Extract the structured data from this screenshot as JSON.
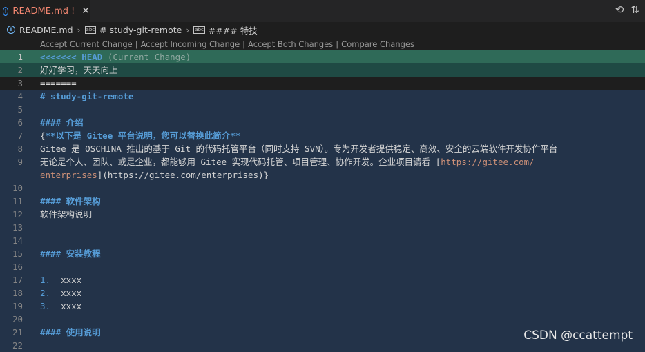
{
  "tab": {
    "filename": "README.md",
    "modified_marker": "!",
    "close": "✕"
  },
  "actions": {
    "timeline": "⟲",
    "compare": "⇅"
  },
  "breadcrumb": {
    "file": "README.md",
    "section1": "# study-git-remote",
    "section2": "#### 特技"
  },
  "codelens": {
    "accept_current": "Accept Current Change",
    "accept_incoming": "Accept Incoming Change",
    "accept_both": "Accept Both Changes",
    "compare": "Compare Changes",
    "separator": "|"
  },
  "lines": [
    {
      "n": "1",
      "parts": [
        {
          "t": "<<<<<<< HEAD ",
          "c": "kw"
        },
        {
          "t": "(Current Change)",
          "c": "dim"
        }
      ],
      "bg": "current"
    },
    {
      "n": "2",
      "parts": [
        {
          "t": "好好学习，天天向上",
          "c": ""
        }
      ],
      "bg": "currentc"
    },
    {
      "n": "3",
      "parts": [
        {
          "t": "=======",
          "c": ""
        }
      ],
      "bg": ""
    },
    {
      "n": "4",
      "parts": [
        {
          "t": "# study-git-remote",
          "c": "kw"
        }
      ],
      "bg": "incoming"
    },
    {
      "n": "5",
      "parts": [],
      "bg": "incoming"
    },
    {
      "n": "6",
      "parts": [
        {
          "t": "#### 介绍",
          "c": "kw"
        }
      ],
      "bg": "incoming"
    },
    {
      "n": "7",
      "parts": [
        {
          "t": "{",
          "c": ""
        },
        {
          "t": "**以下是 Gitee 平台说明，您可以替换此简介**",
          "c": "kw"
        }
      ],
      "bg": "incoming"
    },
    {
      "n": "8",
      "parts": [
        {
          "t": "Gitee 是 OSCHINA 推出的基于 Git 的代码托管平台（同时支持 SVN）。专为开发者提供稳定、高效、安全的云端软件开发协作平台",
          "c": ""
        }
      ],
      "bg": "incoming"
    },
    {
      "n": "9",
      "parts": [
        {
          "t": "无论是个人、团队、或是企业，都能够用 Gitee 实现代码托管、项目管理、协作开发。企业项目请看 [",
          "c": ""
        },
        {
          "t": "https://gitee.com/",
          "c": "link"
        }
      ],
      "bg": "incoming"
    },
    {
      "n": "",
      "parts": [
        {
          "t": "enterprises",
          "c": "link"
        },
        {
          "t": "](https://gitee.com/enterprises)}",
          "c": ""
        }
      ],
      "bg": "incoming"
    },
    {
      "n": "10",
      "parts": [],
      "bg": "incoming"
    },
    {
      "n": "11",
      "parts": [
        {
          "t": "#### 软件架构",
          "c": "kw"
        }
      ],
      "bg": "incoming"
    },
    {
      "n": "12",
      "parts": [
        {
          "t": "软件架构说明",
          "c": ""
        }
      ],
      "bg": "incoming"
    },
    {
      "n": "13",
      "parts": [],
      "bg": "incoming"
    },
    {
      "n": "14",
      "parts": [],
      "bg": "incoming"
    },
    {
      "n": "15",
      "parts": [
        {
          "t": "#### 安装教程",
          "c": "kw"
        }
      ],
      "bg": "incoming"
    },
    {
      "n": "16",
      "parts": [],
      "bg": "incoming"
    },
    {
      "n": "17",
      "parts": [
        {
          "t": "1.  ",
          "c": "num"
        },
        {
          "t": "xxxx",
          "c": ""
        }
      ],
      "bg": "incoming"
    },
    {
      "n": "18",
      "parts": [
        {
          "t": "2.  ",
          "c": "num"
        },
        {
          "t": "xxxx",
          "c": ""
        }
      ],
      "bg": "incoming"
    },
    {
      "n": "19",
      "parts": [
        {
          "t": "3.  ",
          "c": "num"
        },
        {
          "t": "xxxx",
          "c": ""
        }
      ],
      "bg": "incoming"
    },
    {
      "n": "20",
      "parts": [],
      "bg": "incoming"
    },
    {
      "n": "21",
      "parts": [
        {
          "t": "#### 使用说明",
          "c": "kw"
        }
      ],
      "bg": "incoming"
    },
    {
      "n": "22",
      "parts": [],
      "bg": "incoming"
    }
  ],
  "watermark": "CSDN @ccattempt"
}
